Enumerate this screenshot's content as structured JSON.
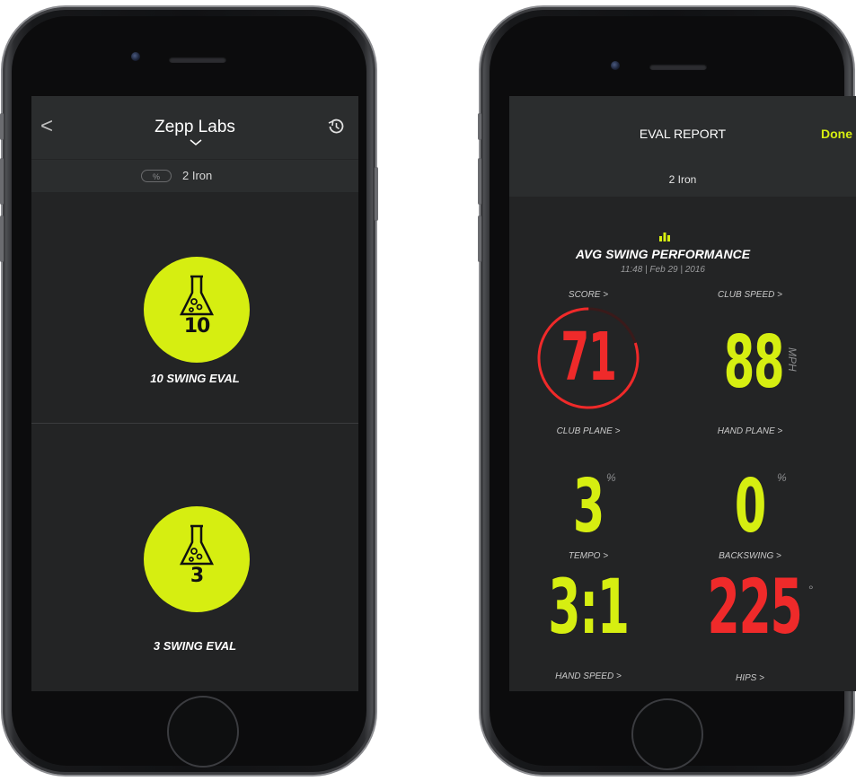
{
  "left_screen": {
    "nav": {
      "back_symbol": "<",
      "title": "Zepp Labs",
      "history_icon": "history-icon"
    },
    "subbar": {
      "pill_text": "%",
      "club": "2 Iron"
    },
    "evals": [
      {
        "number": "10",
        "label": "10 SWING EVAL"
      },
      {
        "number": "3",
        "label": "3 SWING EVAL"
      }
    ]
  },
  "right_screen": {
    "nav": {
      "title": "EVAL REPORT",
      "done_label": "Done"
    },
    "subbar": {
      "club": "2 Iron"
    },
    "performance": {
      "title": "AVG SWING PERFORMANCE",
      "date": "11:48 | Feb 29 | 2016"
    },
    "metrics": {
      "score": {
        "label": "SCORE >",
        "value": "71",
        "ring_fraction": 0.8
      },
      "club_speed": {
        "label": "CLUB SPEED >",
        "value": "88",
        "unit": "MPH"
      },
      "club_plane": {
        "label": "CLUB PLANE >",
        "value": "3",
        "unit": "%"
      },
      "hand_plane": {
        "label": "HAND PLANE >",
        "value": "0",
        "unit": "%"
      },
      "tempo": {
        "label": "TEMPO >",
        "value": "3:1"
      },
      "backswing": {
        "label": "BACKSWING >",
        "value": "225",
        "unit": "°"
      },
      "hand_speed": {
        "label": "HAND SPEED >"
      },
      "hips": {
        "label": "HIPS >"
      }
    }
  },
  "colors": {
    "accent": "#d6ee11",
    "danger": "#ef2a2a",
    "background": "#232425",
    "bar": "#2b2d2e"
  }
}
